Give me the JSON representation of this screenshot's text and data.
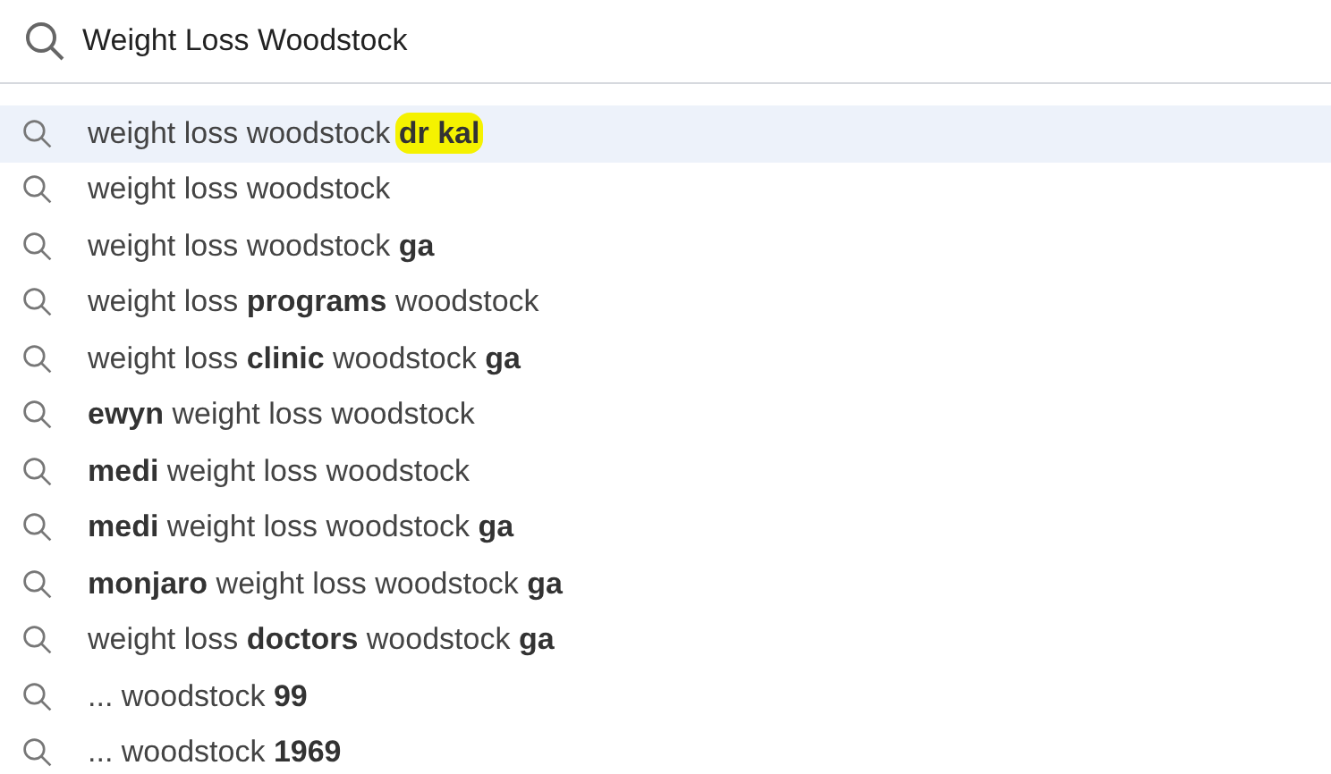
{
  "search": {
    "value": "Weight Loss Woodstock"
  },
  "suggestions": [
    {
      "selected": true,
      "parts": [
        {
          "text": "weight loss woodstock ",
          "bold": false,
          "highlighted": false
        },
        {
          "text": "dr kal",
          "bold": true,
          "highlighted": true
        }
      ]
    },
    {
      "selected": false,
      "parts": [
        {
          "text": "weight loss woodstock",
          "bold": false,
          "highlighted": false
        }
      ]
    },
    {
      "selected": false,
      "parts": [
        {
          "text": "weight loss woodstock ",
          "bold": false,
          "highlighted": false
        },
        {
          "text": "ga",
          "bold": true,
          "highlighted": false
        }
      ]
    },
    {
      "selected": false,
      "parts": [
        {
          "text": "weight loss ",
          "bold": false,
          "highlighted": false
        },
        {
          "text": "programs",
          "bold": true,
          "highlighted": false
        },
        {
          "text": " woodstock",
          "bold": false,
          "highlighted": false
        }
      ]
    },
    {
      "selected": false,
      "parts": [
        {
          "text": "weight loss ",
          "bold": false,
          "highlighted": false
        },
        {
          "text": "clinic",
          "bold": true,
          "highlighted": false
        },
        {
          "text": " woodstock ",
          "bold": false,
          "highlighted": false
        },
        {
          "text": "ga",
          "bold": true,
          "highlighted": false
        }
      ]
    },
    {
      "selected": false,
      "parts": [
        {
          "text": "ewyn",
          "bold": true,
          "highlighted": false
        },
        {
          "text": " weight loss woodstock",
          "bold": false,
          "highlighted": false
        }
      ]
    },
    {
      "selected": false,
      "parts": [
        {
          "text": "medi",
          "bold": true,
          "highlighted": false
        },
        {
          "text": " weight loss woodstock",
          "bold": false,
          "highlighted": false
        }
      ]
    },
    {
      "selected": false,
      "parts": [
        {
          "text": "medi",
          "bold": true,
          "highlighted": false
        },
        {
          "text": " weight loss woodstock ",
          "bold": false,
          "highlighted": false
        },
        {
          "text": "ga",
          "bold": true,
          "highlighted": false
        }
      ]
    },
    {
      "selected": false,
      "parts": [
        {
          "text": "monjaro",
          "bold": true,
          "highlighted": false
        },
        {
          "text": " weight loss woodstock ",
          "bold": false,
          "highlighted": false
        },
        {
          "text": "ga",
          "bold": true,
          "highlighted": false
        }
      ]
    },
    {
      "selected": false,
      "parts": [
        {
          "text": "weight loss ",
          "bold": false,
          "highlighted": false
        },
        {
          "text": "doctors",
          "bold": true,
          "highlighted": false
        },
        {
          "text": " woodstock ",
          "bold": false,
          "highlighted": false
        },
        {
          "text": "ga",
          "bold": true,
          "highlighted": false
        }
      ]
    },
    {
      "selected": false,
      "parts": [
        {
          "text": "... woodstock ",
          "bold": false,
          "highlighted": false
        },
        {
          "text": "99",
          "bold": true,
          "highlighted": false
        }
      ]
    },
    {
      "selected": false,
      "parts": [
        {
          "text": "... woodstock ",
          "bold": false,
          "highlighted": false
        },
        {
          "text": "1969",
          "bold": true,
          "highlighted": false
        }
      ]
    }
  ]
}
